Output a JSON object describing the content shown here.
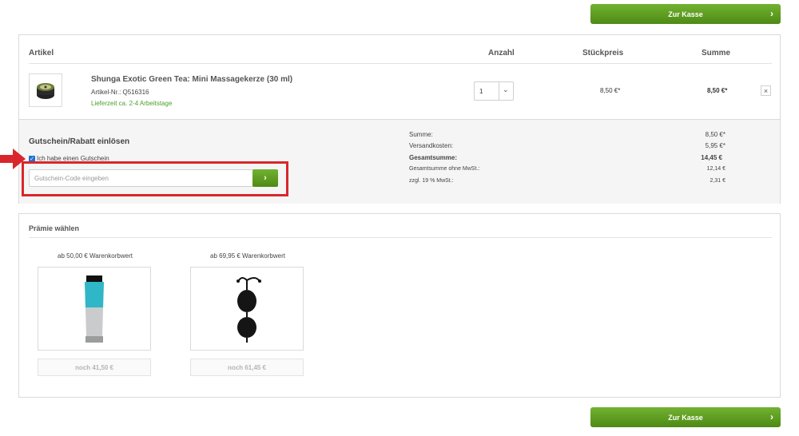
{
  "checkout": {
    "label": "Zur Kasse"
  },
  "cart": {
    "headers": {
      "item": "Artikel",
      "qty": "Anzahl",
      "unit_price": "Stückpreis",
      "sum": "Summe"
    },
    "items": [
      {
        "name": "Shunga Exotic Green Tea: Mini Massagekerze (30 ml)",
        "sku": "Artikel-Nr.: Q516316",
        "delivery": "Lieferzeit ca. 2-4 Arbeitstage",
        "qty": "1",
        "unit_price": "8,50 €*",
        "total": "8,50 €*"
      }
    ]
  },
  "voucher": {
    "title": "Gutschein/Rabatt einlösen",
    "checkbox_label": "Ich habe einen Gutschein",
    "checked": true,
    "placeholder": "Gutschein-Code eingeben"
  },
  "summary": {
    "rows": [
      {
        "label": "Summe:",
        "value": "8,50 €*"
      },
      {
        "label": "Versandkosten:",
        "value": "5,95 €*"
      },
      {
        "label": "Gesamtsumme:",
        "value": "14,45 €"
      },
      {
        "label": "Gesamtsumme ohne MwSt.:",
        "value": "12,14 €"
      },
      {
        "label": "zzgl. 19 % MwSt.:",
        "value": "2,31 €"
      }
    ]
  },
  "rewards": {
    "title": "Prämie wählen",
    "items": [
      {
        "threshold": "ab 50,00 € Warenkorbwert",
        "button": "noch 41,50 €"
      },
      {
        "threshold": "ab 69,95 € Warenkorbwert",
        "button": "noch 61,45 €"
      }
    ]
  },
  "colors": {
    "accent": "#5e9c1f",
    "highlight": "#d9262c",
    "delivery": "#4aa02c"
  }
}
